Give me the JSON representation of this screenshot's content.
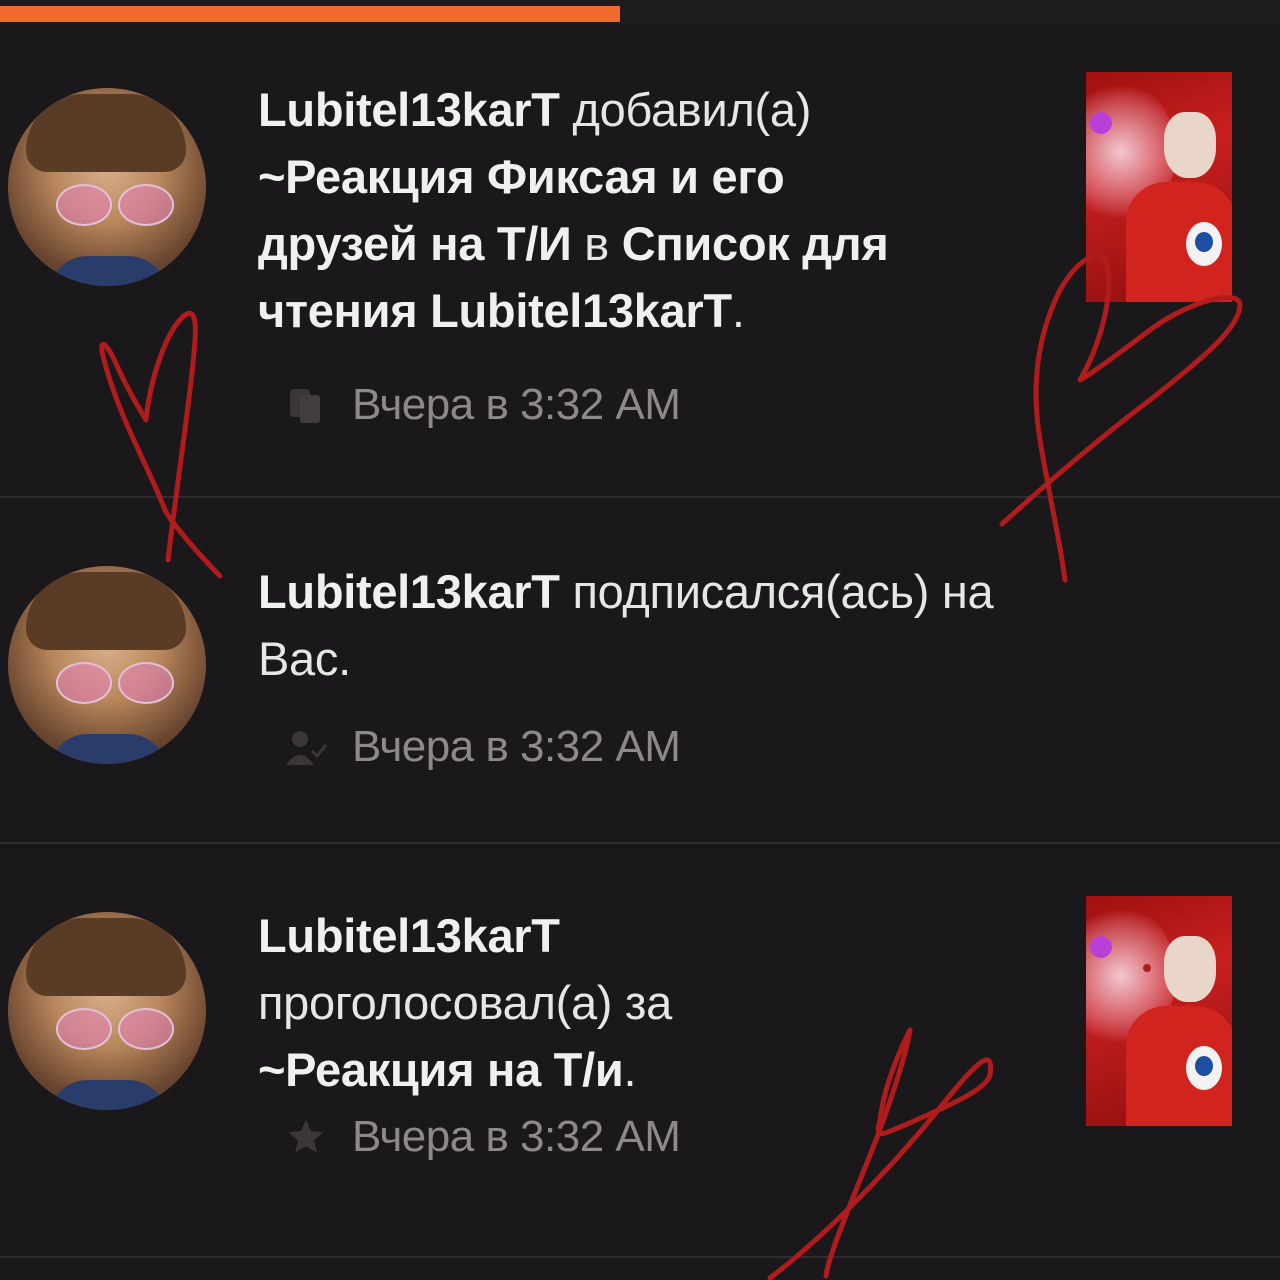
{
  "progress_fraction": 0.484,
  "colors": {
    "accent": "#f26a2e",
    "background": "#1b181b",
    "divider": "#302c30",
    "doodle": "#b01c1c"
  },
  "notifications": [
    {
      "line1_bold": "Lubitel13karT",
      "line1_rest": " добавил(а)",
      "line2": "~Реакция Фиксая и его",
      "line3": "друзей на Т/И",
      "line3_rest": " в ",
      "line3_bold2": "Список для",
      "line4_bold": "чтения Lubitel13karT",
      "line4_rest": ".",
      "icon": "reading-list-icon",
      "time": "Вчера в 3:32 AM"
    },
    {
      "line1_bold": "Lubitel13karT",
      "line1_rest": " подписался(ась) на",
      "line2": "Вас.",
      "icon": "follow-icon",
      "time": "Вчера в 3:32 AM"
    },
    {
      "line1_bold": "Lubitel13karT",
      "line2": "проголосовал(а) за",
      "line3_bold": "~Реакция на Т/и",
      "line3_rest": ".",
      "icon": "vote-star-icon",
      "time": "Вчера в 3:32 AM"
    }
  ]
}
